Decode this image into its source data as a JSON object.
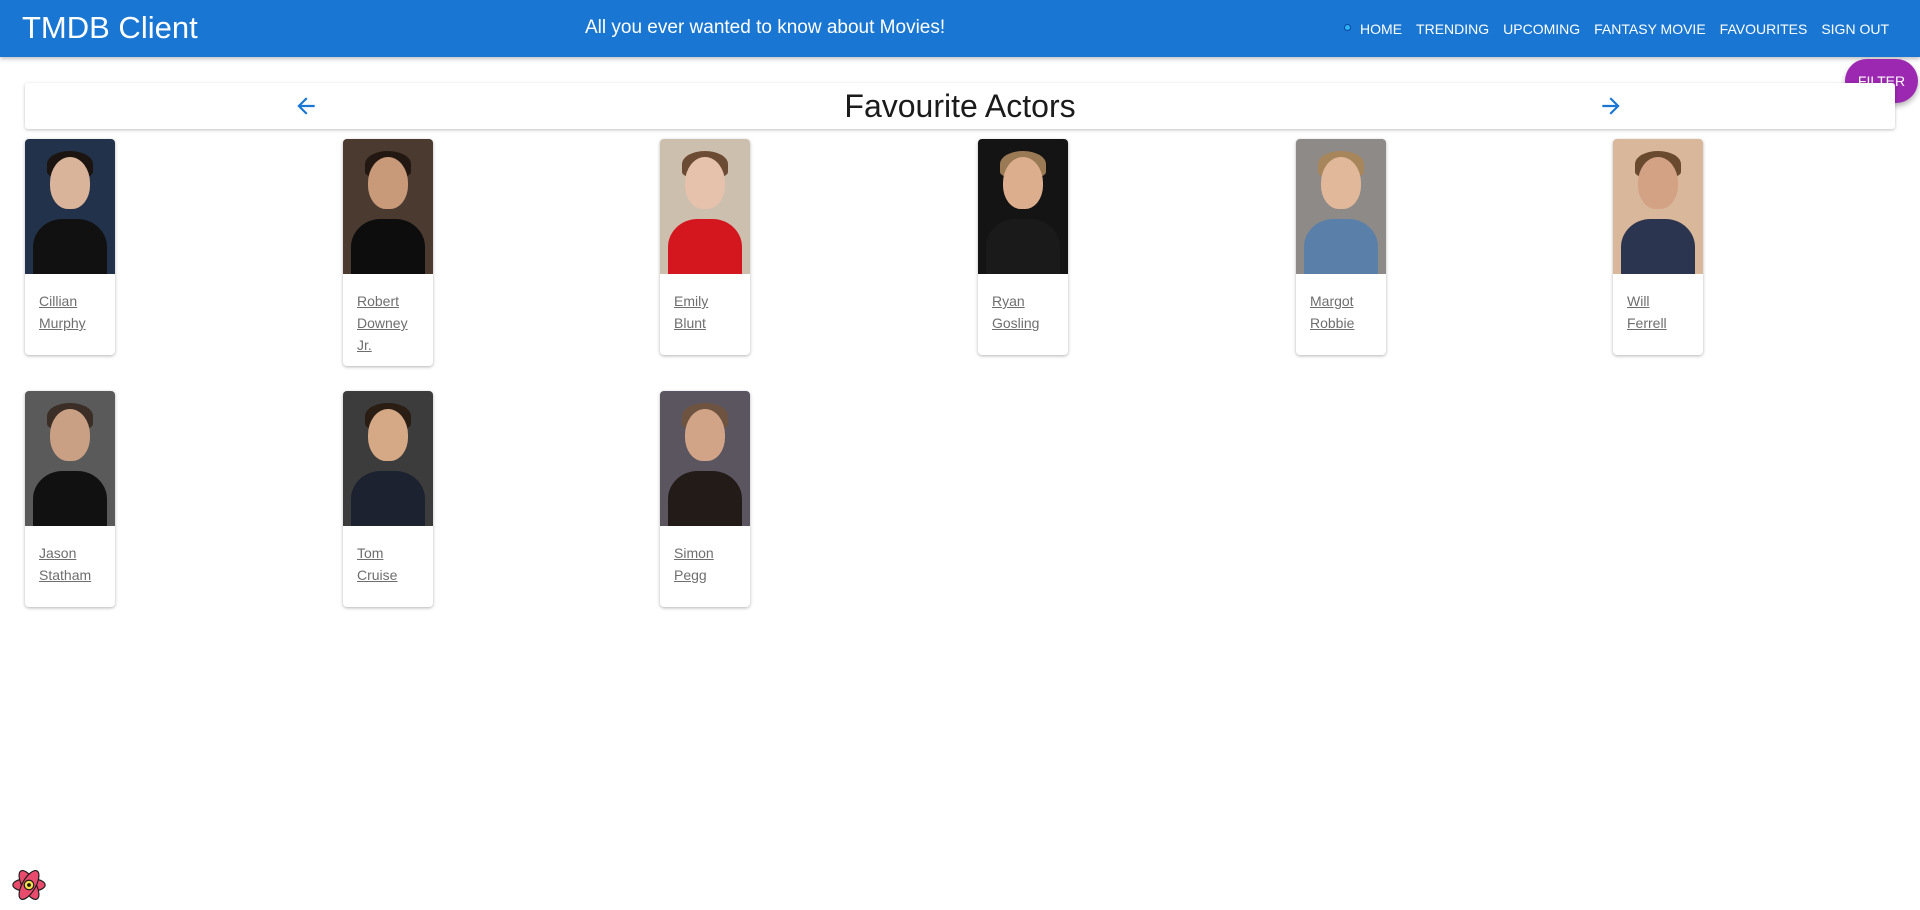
{
  "appbar": {
    "title": "TMDB Client",
    "tagline": "All you ever wanted to know about Movies!",
    "nav": [
      "HOME",
      "TRENDING",
      "UPCOMING",
      "FANTASY MOVIE",
      "FAVOURITES",
      "SIGN OUT"
    ]
  },
  "filter_label": "FILTER",
  "page_title": "Favourite Actors",
  "icons": {
    "back": "arrow-left-icon",
    "forward": "arrow-right-icon",
    "devtools": "react-logo-icon"
  },
  "colors": {
    "appbar": "#1976d2",
    "filter_fab": "#9c27b0",
    "arrow": "#1976d2"
  },
  "actors": [
    {
      "name": "Cillian Murphy",
      "bg": "#22324a",
      "skin": "#d9b49a",
      "hair": "#1b1410",
      "shirt": "#111111"
    },
    {
      "name": "Robert Downey Jr.",
      "bg": "#4a3a30",
      "skin": "#c99a7a",
      "hair": "#231811",
      "shirt": "#0d0d0d"
    },
    {
      "name": "Emily Blunt",
      "bg": "#cdbfae",
      "skin": "#e6c2ad",
      "hair": "#6b4b34",
      "shirt": "#d4161f"
    },
    {
      "name": "Ryan Gosling",
      "bg": "#141414",
      "skin": "#dcae8e",
      "hair": "#9a7a55",
      "shirt": "#1a1a1a"
    },
    {
      "name": "Margot Robbie",
      "bg": "#8d8a88",
      "skin": "#e2b89b",
      "hair": "#a8865c",
      "shirt": "#5a7fa8"
    },
    {
      "name": "Will Ferrell",
      "bg": "#d8b79a",
      "skin": "#d3a285",
      "hair": "#6a4a2f",
      "shirt": "#2c3550"
    },
    {
      "name": "Jason Statham",
      "bg": "#5a5a5a",
      "skin": "#c9a083",
      "hair": "#3a2e26",
      "shirt": "#111111"
    },
    {
      "name": "Tom Cruise",
      "bg": "#3c3c3c",
      "skin": "#d6a986",
      "hair": "#2a1d14",
      "shirt": "#1c2230"
    },
    {
      "name": "Simon Pegg",
      "bg": "#5b5560",
      "skin": "#d1a488",
      "hair": "#6d5340",
      "shirt": "#231b17"
    }
  ]
}
